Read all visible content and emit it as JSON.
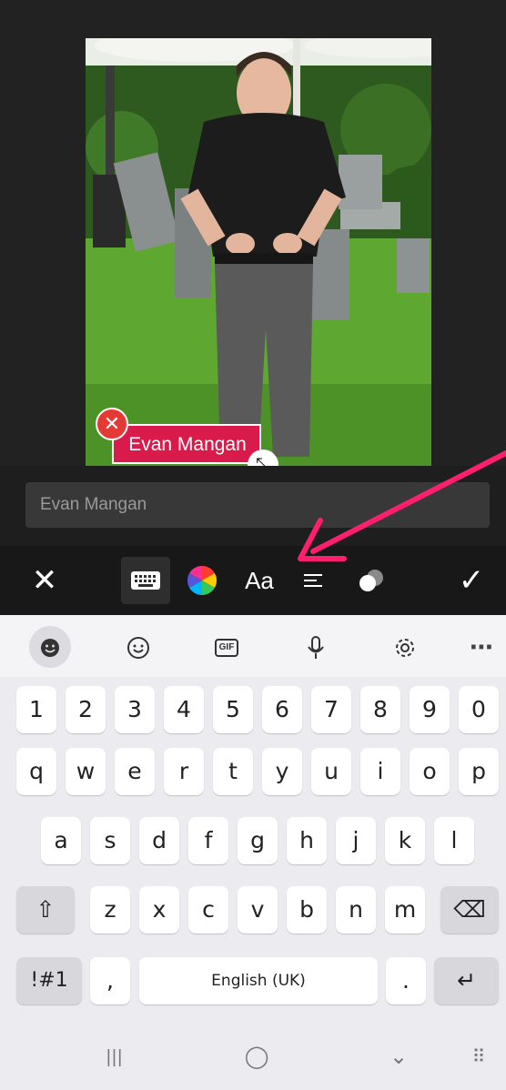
{
  "caption": {
    "text": "Evan Mangan",
    "delete_glyph": "✕",
    "resize_glyph": "⤡"
  },
  "text_input": {
    "value": "Evan Mangan"
  },
  "toolbar": {
    "close_glyph": "✕",
    "font_label": "Aa",
    "done_glyph": "✓",
    "icons": [
      "keyboard-icon",
      "color-wheel-icon",
      "font-icon",
      "align-icon",
      "style-icon"
    ]
  },
  "annotation": {
    "arrow_color": "#ff1f6e"
  },
  "keyboard_toolbar": {
    "more_glyph": "⋯",
    "icons": [
      "emoji-face-icon",
      "smiley-icon",
      "gif-icon",
      "microphone-icon",
      "settings-icon",
      "more-icon"
    ],
    "gif_label": "GIF"
  },
  "keyboard": {
    "number_row": [
      "1",
      "2",
      "3",
      "4",
      "5",
      "6",
      "7",
      "8",
      "9",
      "0"
    ],
    "row1": [
      "q",
      "w",
      "e",
      "r",
      "t",
      "y",
      "u",
      "i",
      "o",
      "p"
    ],
    "row2": [
      "a",
      "s",
      "d",
      "f",
      "g",
      "h",
      "j",
      "k",
      "l"
    ],
    "row3": [
      "z",
      "x",
      "c",
      "v",
      "b",
      "n",
      "m"
    ],
    "symbols_label": "!#1",
    "comma": ",",
    "space_label": "English (UK)",
    "period": ".",
    "shift_glyph": "⇧",
    "backspace_glyph": "⌫",
    "enter_glyph": "↵"
  },
  "navigation": {
    "recent_glyph": "|||",
    "home_glyph": "◯",
    "back_glyph": "⌄",
    "keyboard_glyph": "⠿"
  }
}
